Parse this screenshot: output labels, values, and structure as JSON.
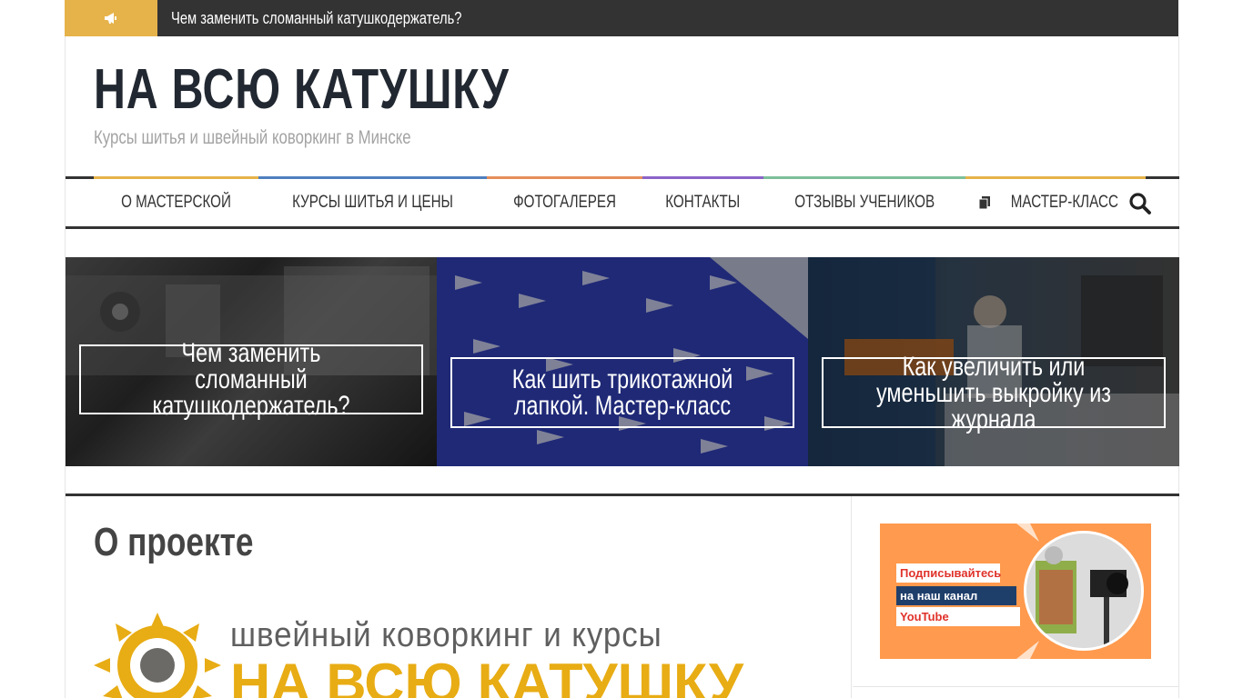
{
  "ticker": {
    "icon": "bullhorn-icon",
    "text": "Чем заменить сломанный катушкодержатель?"
  },
  "site": {
    "title": "НА ВСЮ КАТУШКУ",
    "tagline": "Курсы шитья и швейный коворкинг в Минске"
  },
  "nav": {
    "items": [
      {
        "label": "О мастерской",
        "accent": "#e6b34a"
      },
      {
        "label": "Курсы шитья и цены",
        "accent": "#4f7fbf"
      },
      {
        "label": "Фотогалерея",
        "accent": "#e58e5a"
      },
      {
        "label": "Контакты",
        "accent": "#8b64c8"
      },
      {
        "label": "Отзывы учеников",
        "accent": "#7cbf9a"
      },
      {
        "label": "Мастер-класс",
        "accent": "#e6b34a",
        "icon": "book-icon"
      }
    ],
    "search_icon": "search-icon"
  },
  "slider": {
    "slides": [
      {
        "title": "Чем заменить сломанный катушкодержатель?"
      },
      {
        "title": "Как шить трикотажной лапкой. Мастер-класс"
      },
      {
        "title": "Как увеличить или уменьшить выкройку из журнала"
      }
    ]
  },
  "main": {
    "heading": "О проекте",
    "logo_line1": "швейный коворкинг и курсы",
    "logo_line2": "НА ВСЮ КАТУШКУ"
  },
  "sidebar": {
    "banner_lines": [
      "Подписывайтесь",
      "на наш канал",
      "YouTube"
    ]
  },
  "colors": {
    "ticker_bg": "#333333",
    "ticker_accent": "#e6b34a",
    "title": "#222831",
    "tagline": "#a3a3a3",
    "banner_bg": "#ff9a4e",
    "logo_gold": "#e8ac14"
  }
}
